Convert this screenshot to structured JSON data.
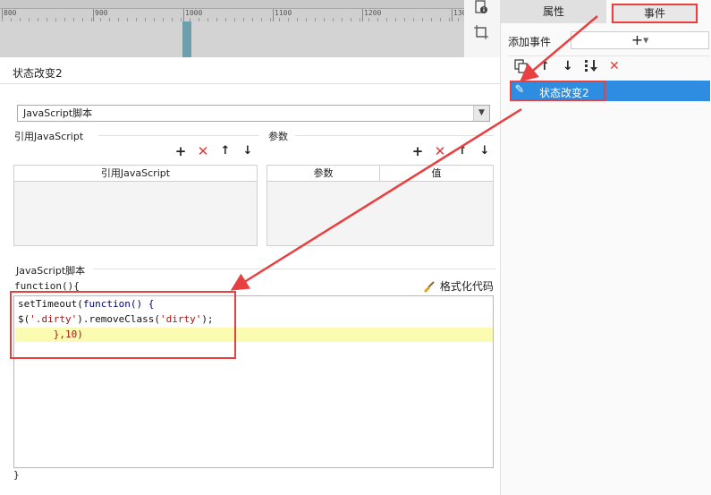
{
  "ruler": {
    "labels": [
      "800",
      "900",
      "1000",
      "1100",
      "1200",
      "130"
    ]
  },
  "dialog": {
    "title": "状态改变2",
    "action_select": "JavaScript脚本",
    "ref_js_label": "引用JavaScript",
    "ref_js_column": "引用JavaScript",
    "params_label": "参数",
    "params_col_param": "参数",
    "params_col_value": "值",
    "script_label": "JavaScript脚本",
    "function_open": "function(){",
    "function_close": "}",
    "format_code_label": "格式化代码",
    "code": {
      "line1_a": "setTimeout(",
      "line1_kw": "function",
      "line1_b": "() {",
      "line2_a": "$(",
      "line2_str": "'.dirty'",
      "line2_b": ").removeClass(",
      "line2_str2": "'dirty'",
      "line2_c": ");",
      "line3_a": "      },",
      "line3_num": "10",
      "line3_b": ")"
    }
  },
  "right_panel": {
    "tab_props": "属性",
    "tab_events": "事件",
    "add_event_label": "添加事件",
    "add_event_button": "+",
    "event_item": "状态改变2"
  },
  "icons": {
    "plus": "+",
    "delete": "✕",
    "up": "↑",
    "down": "↓"
  },
  "colors": {
    "accent": "#2e8de0",
    "annotation_red": "#e84040",
    "highlight_line": "#fbfbb2"
  }
}
